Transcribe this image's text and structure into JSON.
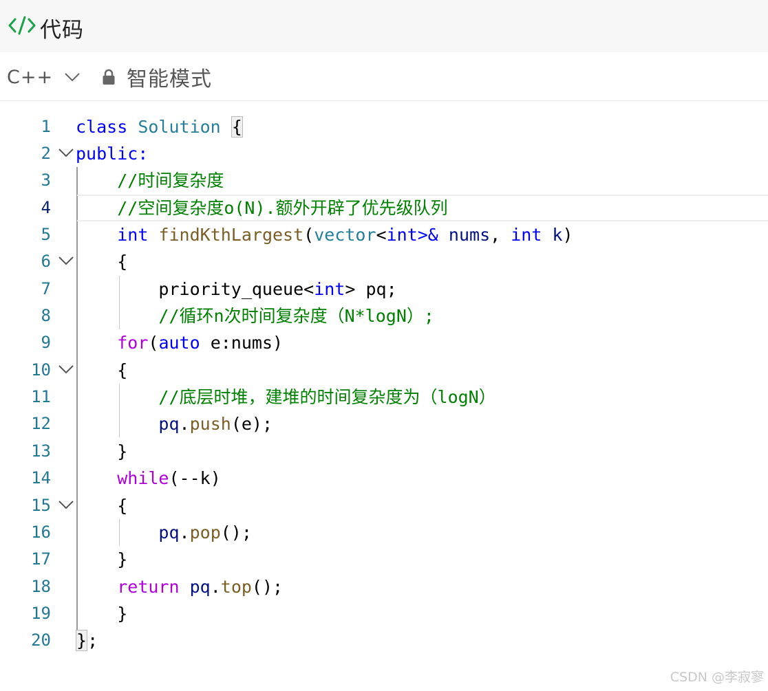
{
  "header": {
    "icon": "code-icon",
    "title": "代码"
  },
  "toolbar": {
    "language": "C++",
    "mode_label": "智能模式",
    "lock_icon": "lock-icon"
  },
  "editor": {
    "active_line": 4,
    "lines": [
      {
        "n": "1"
      },
      {
        "n": "2"
      },
      {
        "n": "3"
      },
      {
        "n": "4"
      },
      {
        "n": "5"
      },
      {
        "n": "6"
      },
      {
        "n": "7"
      },
      {
        "n": "8"
      },
      {
        "n": "9"
      },
      {
        "n": "10"
      },
      {
        "n": "11"
      },
      {
        "n": "12"
      },
      {
        "n": "13"
      },
      {
        "n": "14"
      },
      {
        "n": "15"
      },
      {
        "n": "16"
      },
      {
        "n": "17"
      },
      {
        "n": "18"
      },
      {
        "n": "19"
      },
      {
        "n": "20"
      }
    ],
    "tokens": {
      "l1": [
        "class",
        "Solution",
        "{"
      ],
      "l2": [
        "public:"
      ],
      "l3": [
        "//时间复杂度"
      ],
      "l4": [
        "//空间复杂度o(N).额外开辟了优先级队列"
      ],
      "l5": [
        "int",
        "findKthLargest",
        "(",
        "vector",
        "<",
        "int",
        ">&",
        "nums",
        ", ",
        "int",
        "k",
        ")"
      ],
      "l6": [
        "{"
      ],
      "l7": [
        "priority_queue<",
        "int",
        "> pq;"
      ],
      "l8": [
        "//循环n次时间复杂度（N*logN）;"
      ],
      "l9": [
        "for",
        "(",
        "auto",
        " e:nums)"
      ],
      "l10": [
        "{"
      ],
      "l11": [
        "//底层时堆，建堆的时间复杂度为（logN）"
      ],
      "l12": [
        "pq",
        ".",
        "push",
        "(e);"
      ],
      "l13": [
        "}"
      ],
      "l14": [
        "while",
        "(--k)"
      ],
      "l15": [
        "{"
      ],
      "l16": [
        "pq",
        ".",
        "pop",
        "();"
      ],
      "l17": [
        "}"
      ],
      "l18": [
        "return",
        "pq",
        ".",
        "top",
        "();"
      ],
      "l19": [
        "}"
      ],
      "l20": [
        "}",
        ";"
      ]
    }
  },
  "watermark": "CSDN @李寂寥",
  "colors": {
    "keyword": "#0000ff",
    "type": "#267f99",
    "function": "#795e26",
    "comment": "#008000",
    "control": "#af00db",
    "variable": "#001080",
    "line_number": "#237893"
  }
}
